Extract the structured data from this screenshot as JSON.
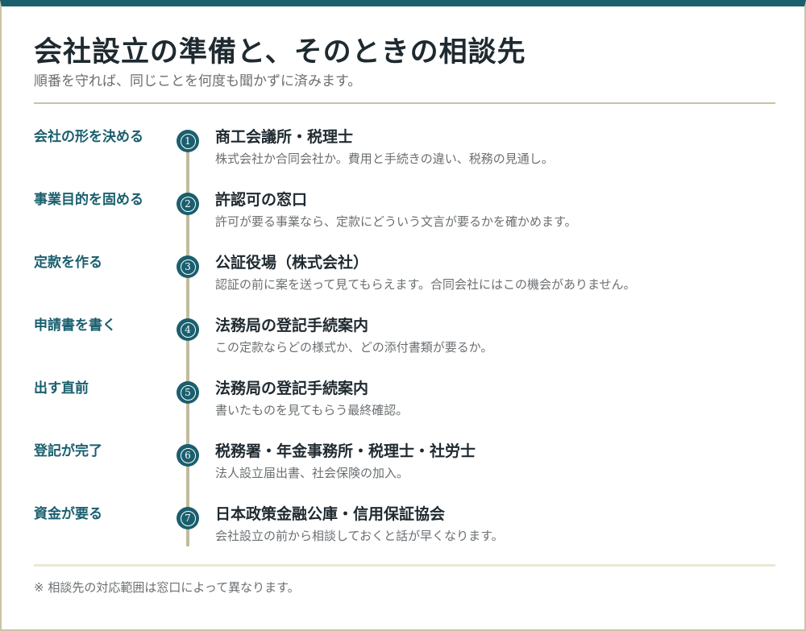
{
  "header": {
    "title": "会社設立の準備と、そのときの相談先",
    "subtitle": "順番を守れば、同じことを何度も聞かずに済みます。"
  },
  "steps": [
    {
      "number": "1",
      "label": "会社の形を決める",
      "office": "商工会議所・税理士",
      "desc": "株式会社か合同会社か。費用と手続きの違い、税務の見通し。"
    },
    {
      "number": "2",
      "label": "事業目的を固める",
      "office": "許認可の窓口",
      "desc": "許可が要る事業なら、定款にどういう文言が要るかを確かめます。"
    },
    {
      "number": "3",
      "label": "定款を作る",
      "office": "公証役場（株式会社）",
      "desc": "認証の前に案を送って見てもらえます。合同会社にはこの機会がありません。"
    },
    {
      "number": "4",
      "label": "申請書を書く",
      "office": "法務局の登記手続案内",
      "desc": "この定款ならどの様式か、どの添付書類が要るか。"
    },
    {
      "number": "5",
      "label": "出す直前",
      "office": "法務局の登記手続案内",
      "desc": "書いたものを見てもらう最終確認。"
    },
    {
      "number": "6",
      "label": "登記が完了",
      "office": "税務署・年金事務所・税理士・社労士",
      "desc": "法人設立届出書、社会保険の加入。"
    },
    {
      "number": "7",
      "label": "資金が要る",
      "office": "日本政策金融公庫・信用保証協会",
      "desc": "会社設立の前から相談しておくと話が早くなります。"
    }
  ],
  "footer": {
    "note": "※ 相談先の対応範囲は窓口によって異なります。"
  },
  "colors": {
    "accent": "#1a5f6e",
    "rule": "#c9c3a6",
    "timeline": "#c2bb9d"
  }
}
